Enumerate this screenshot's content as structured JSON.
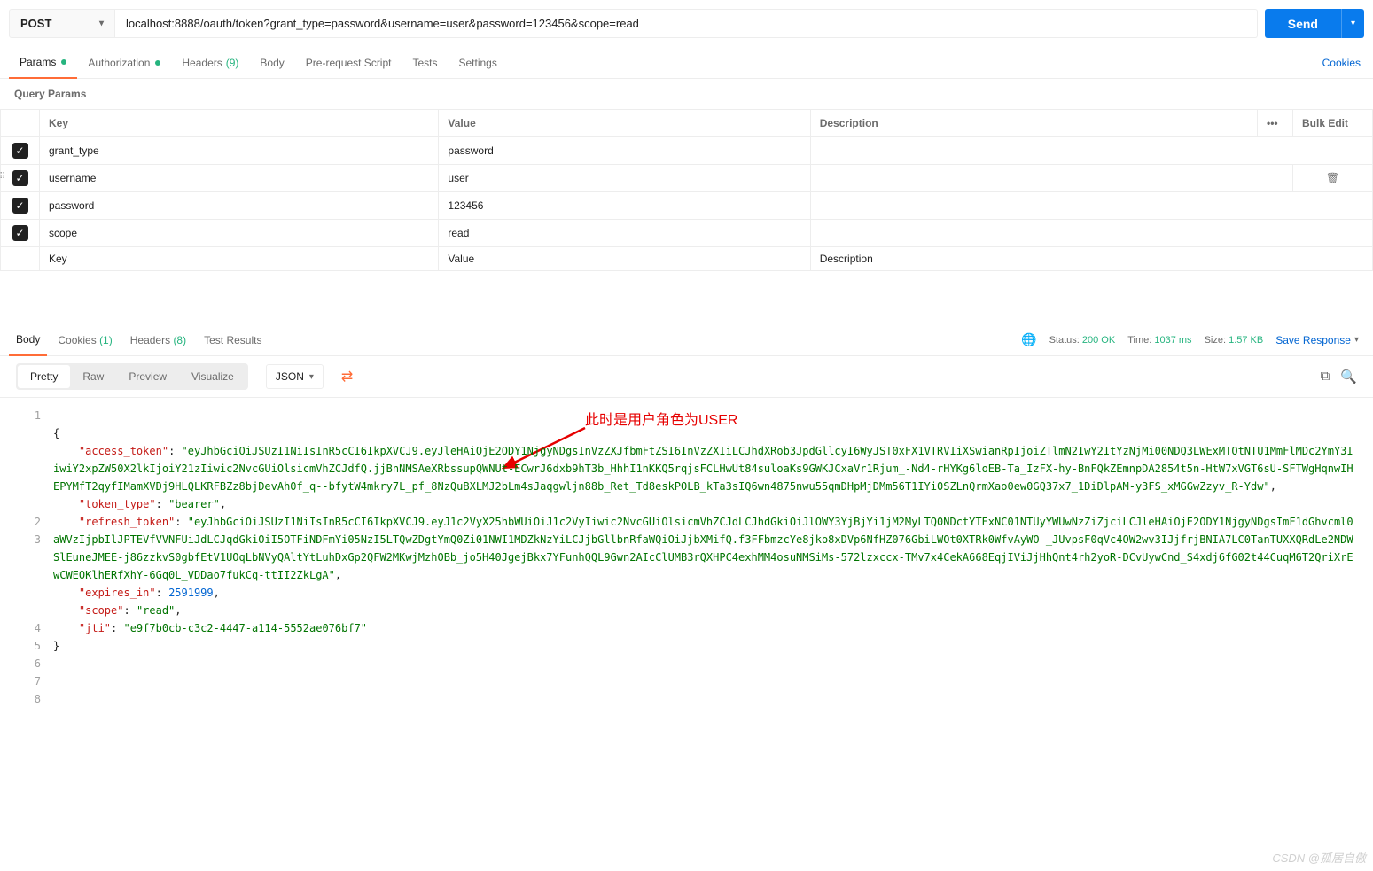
{
  "request": {
    "method": "POST",
    "url": "localhost:8888/oauth/token?grant_type=password&username=user&password=123456&scope=read",
    "send_label": "Send"
  },
  "tabs": {
    "params": "Params",
    "auth": "Authorization",
    "headers": "Headers",
    "headers_count": "(9)",
    "body": "Body",
    "prerequest": "Pre-request Script",
    "tests": "Tests",
    "settings": "Settings",
    "cookies": "Cookies"
  },
  "params": {
    "title": "Query Params",
    "cols": {
      "key": "Key",
      "value": "Value",
      "desc": "Description",
      "bulk": "Bulk Edit"
    },
    "rows": [
      {
        "key": "grant_type",
        "value": "password"
      },
      {
        "key": "username",
        "value": "user"
      },
      {
        "key": "password",
        "value": "123456"
      },
      {
        "key": "scope",
        "value": "read"
      }
    ],
    "placeholder": {
      "key": "Key",
      "value": "Value",
      "desc": "Description"
    }
  },
  "response_tabs": {
    "body": "Body",
    "cookies": "Cookies",
    "cookies_count": "(1)",
    "headers": "Headers",
    "headers_count": "(8)",
    "test_results": "Test Results"
  },
  "status": {
    "label": "Status:",
    "code": "200 OK",
    "time_label": "Time:",
    "time": "1037 ms",
    "size_label": "Size:",
    "size": "1.57 KB",
    "save": "Save Response"
  },
  "view": {
    "pretty": "Pretty",
    "raw": "Raw",
    "preview": "Preview",
    "visualize": "Visualize",
    "format": "JSON"
  },
  "json_body": {
    "access_token_key": "\"access_token\"",
    "access_token_val": "\"eyJhbGciOiJSUzI1NiIsInR5cCI6IkpXVCJ9.eyJleHAiOjE2ODY1NjgyNDgsInVzZXJfbmFtZSI6InVzZXIiLCJhdXRob3JpdGllcyI6WyJST0xFX1VTRVIiXSwianRpIjoiZTlmN2IwY2ItYzNjMi00NDQ3LWExMTQtNTU1MmFlMDc2YmY3IiwiY2xpZW50X2lkIjoiY21zIiwic2NvcGUiOlsicmVhZCJdfQ.jjBnNMSAeXRbssupQWNUt-ECwrJ6dxb9hT3b_HhhI1nKKQ5rqjsFCLHwUt84suloaKs9GWKJCxaVr1Rjum_-Nd4-rHYKg6loEB-Ta_IzFX-hy-BnFQkZEmnpDA2854t5n-HtW7xVGT6sU-SFTWgHqnwIHEPYMfT2qyfIMamXVDj9HLQLKRFBZz8bjDevAh0f_q--bfytW4mkry7L_pf_8NzQuBXLMJ2bLm4sJaqgwljn88b_Ret_Td8eskPOLB_kTa3sIQ6wn4875nwu55qmDHpMjDMm56T1IYi0SZLnQrmXao0ew0GQ37x7_1DiDlpAM-y3FS_xMGGwZzyv_R-Ydw\"",
    "token_type_key": "\"token_type\"",
    "token_type_val": "\"bearer\"",
    "refresh_token_key": "\"refresh_token\"",
    "refresh_token_val": "\"eyJhbGciOiJSUzI1NiIsInR5cCI6IkpXVCJ9.eyJ1c2VyX25hbWUiOiJ1c2VyIiwic2NvcGUiOlsicmVhZCJdLCJhdGkiOiJlOWY3YjBjYi1jM2MyLTQ0NDctYTExNC01NTUyYWUwNzZiZjciLCJleHAiOjE2ODY1NjgyNDgsImF1dGhvcml0aWVzIjpbIlJPTEVfVVNFUiJdLCJqdGkiOiI5OTFiNDFmYi05NzI5LTQwZDgtYmQ0Zi01NWI1MDZkNzYiLCJjbGllbnRfaWQiOiJjbXMifQ.f3FFbmzcYe8jko8xDVp6NfHZ076GbiLWOt0XTRk0WfvAyWO-_JUvpsF0qVc4OW2wv3IJjfrjBNIA7LC0TanTUXXQRdLe2NDWSlEuneJMEE-j86zzkvS0gbfEtV1UOqLbNVyQAltYtLuhDxGp2QFW2MKwjMzhOBb_jo5H40JgejBkx7YFunhQQL9Gwn2AIcClUMB3rQXHPC4exhMM4osuNMSiMs-572lzxccx-TMv7x4CekA668EqjIViJjHhQnt4rh2yoR-DCvUywCnd_S4xdj6fG02t44CuqM6T2QriXrEwCWEOKlhERfXhY-6Gq0L_VDDao7fukCq-ttII2ZkLgA\"",
    "expires_in_key": "\"expires_in\"",
    "expires_in_val": "2591999",
    "scope_key": "\"scope\"",
    "scope_val": "\"read\"",
    "jti_key": "\"jti\"",
    "jti_val": "\"e9f7b0cb-c3c2-4447-a114-5552ae076bf7\""
  },
  "annotation": "此时是用户角色为USER",
  "watermark": "CSDN @孤居自傲"
}
